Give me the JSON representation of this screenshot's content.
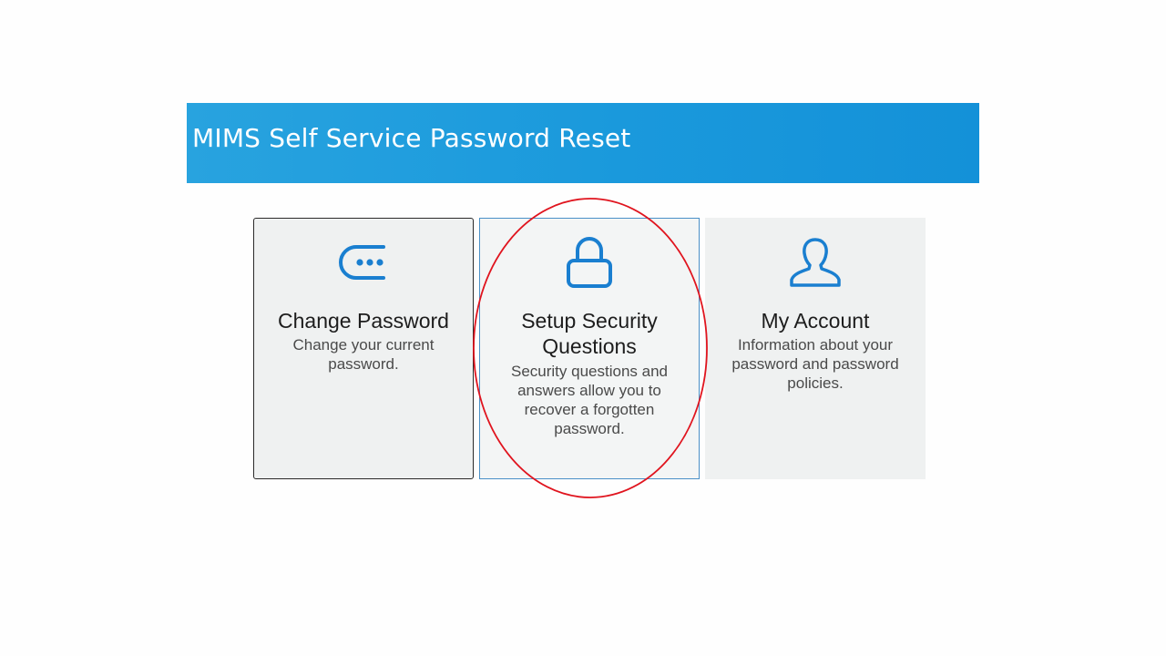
{
  "header": {
    "title": "MIMS Self Service Password Reset",
    "background": "#1a99dc"
  },
  "tiles": [
    {
      "title": "Change Password",
      "description": "Change your current password.",
      "icon": "password-field-icon",
      "state": "selected"
    },
    {
      "title": "Setup Security Questions",
      "description": "Security questions and answers allow you to recover a forgotten password.",
      "icon": "lock-icon",
      "state": "hover"
    },
    {
      "title": "My Account",
      "description": "Information about your password and password policies.",
      "icon": "user-icon",
      "state": "default"
    }
  ],
  "annotation": {
    "type": "ellipse",
    "color": "#e0141e",
    "target": "Setup Security Questions"
  },
  "colors": {
    "icon": "#1a7fd0",
    "tile_background": "#eff1f1"
  }
}
